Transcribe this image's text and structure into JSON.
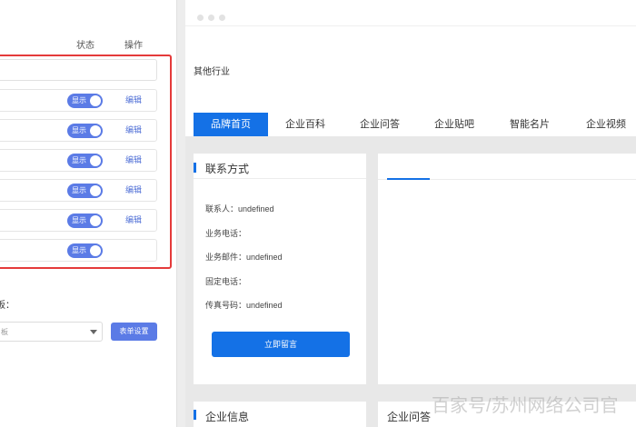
{
  "left_panel": {
    "columns": {
      "status": "状态",
      "operations": "操作"
    },
    "rows": [
      {
        "toggle": "显示",
        "edit": "编辑"
      },
      {
        "toggle": "显示",
        "edit": "编辑"
      },
      {
        "toggle": "显示",
        "edit": "编辑"
      },
      {
        "toggle": "显示",
        "edit": "编辑"
      },
      {
        "toggle": "显示",
        "edit": "编辑"
      },
      {
        "toggle": "显示",
        "edit": ""
      }
    ],
    "template_label": "板：",
    "template_select_value": "板",
    "form_settings_button": "表单设置"
  },
  "preview": {
    "industry": "其他行业",
    "nav_tabs": [
      "品牌首页",
      "企业百科",
      "企业问答",
      "企业贴吧",
      "智能名片",
      "企业视频"
    ],
    "active_tab_index": 0,
    "contact": {
      "title": "联系方式",
      "lines": [
        "联系人：undefined",
        "业务电话：",
        "业务邮件：undefined",
        "固定电话：",
        "传真号码：undefined"
      ],
      "button": "立即留言"
    },
    "company_info_title": "企业信息",
    "qa_title": "企业问答"
  },
  "watermark": "百家号/苏州网络公司官",
  "colors": {
    "accent_blue": "#1471e6",
    "toggle_blue": "#5b7be6",
    "highlight_red": "#e43a3a"
  }
}
